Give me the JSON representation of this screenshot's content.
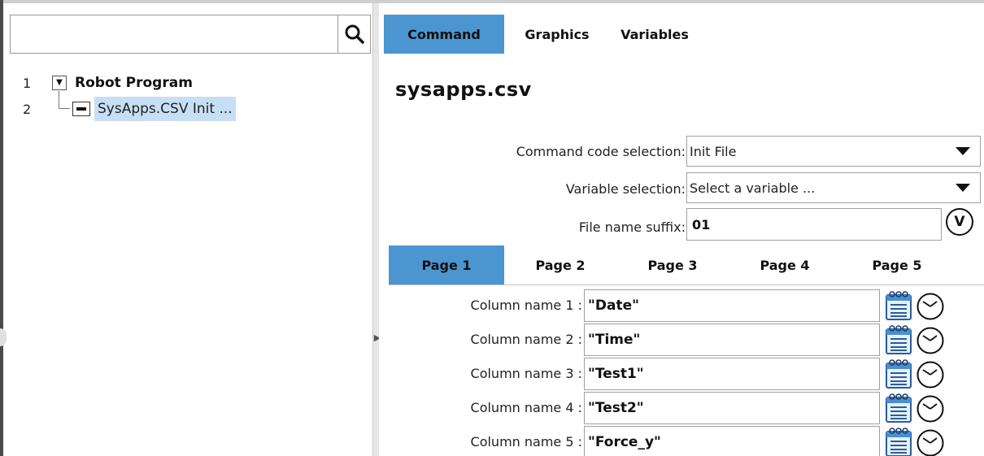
{
  "left": {
    "search": {
      "placeholder": "",
      "value": ""
    },
    "tree": [
      {
        "line": "1",
        "label": "Robot Program"
      },
      {
        "line": "2",
        "label": "SysApps.CSV Init ..."
      }
    ]
  },
  "right": {
    "tabs": [
      {
        "label": "Command",
        "active": true
      },
      {
        "label": "Graphics",
        "active": false
      },
      {
        "label": "Variables",
        "active": false
      }
    ],
    "title": "sysapps.csv",
    "form": {
      "command_label": "Command code selection:",
      "command_value": "Init File",
      "variable_label": "Variable selection:",
      "variable_value": "Select a variable ...",
      "suffix_label": "File name suffix:",
      "suffix_value": "01",
      "v_button": "V"
    },
    "page_tabs": [
      "Page 1",
      "Page 2",
      "Page 3",
      "Page 4",
      "Page 5"
    ],
    "active_page": "Page 1",
    "columns": [
      {
        "label": "Column name 1 :",
        "value": "\"Date\""
      },
      {
        "label": "Column name 2 :",
        "value": "\"Time\""
      },
      {
        "label": "Column name 3 :",
        "value": "\"Test1\""
      },
      {
        "label": "Column name 4 :",
        "value": "\"Test2\""
      },
      {
        "label": "Column name 5 :",
        "value": "\"Force_y\""
      }
    ]
  },
  "icons": [
    "search-icon",
    "expand-toggle-icon",
    "node-collapse-icon",
    "dropdown-arrow-icon",
    "calendar-icon",
    "clock-icon"
  ],
  "colors": {
    "active_tab": "#4b95d1",
    "selection": "#c7dff5"
  }
}
